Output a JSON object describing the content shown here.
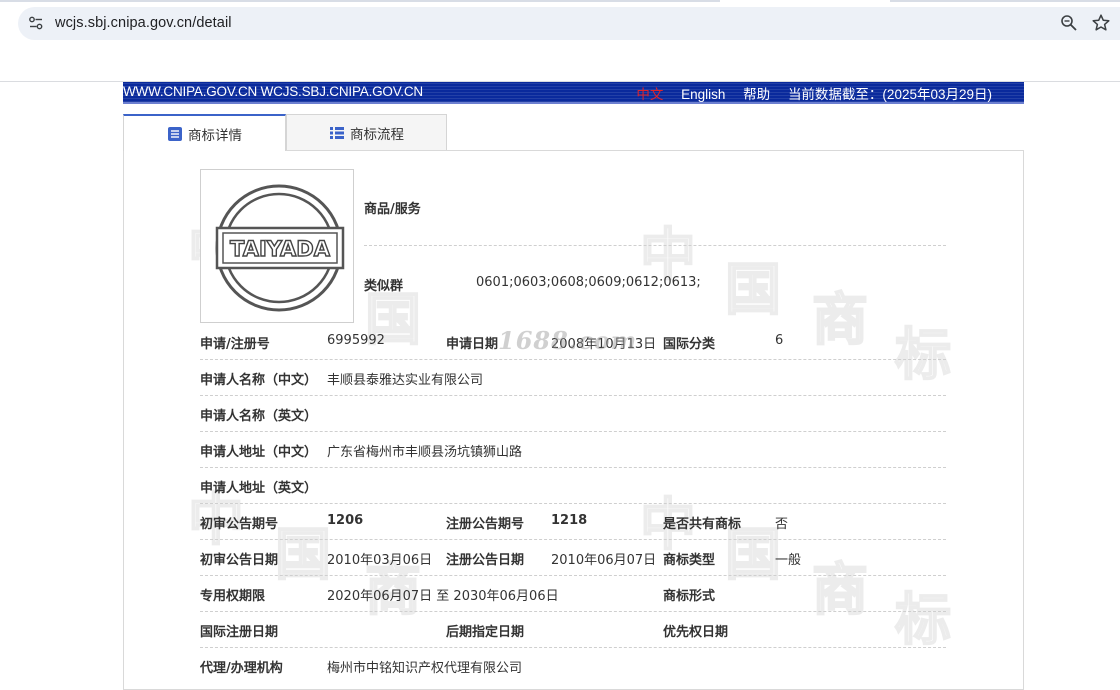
{
  "browser": {
    "url": "wcjs.sbj.cnipa.gov.cn/detail"
  },
  "banner": {
    "sites": "WWW.CNIPA.GOV.CN WCJS.SBJ.CNIPA.GOV.CN",
    "lang_cn": "中文",
    "lang_en": "English",
    "help": "帮助",
    "data_cutoff": "当前数据截至：(2025年03月29日)"
  },
  "tabs": [
    {
      "label": "商标详情",
      "icon": "document-icon",
      "active": true
    },
    {
      "label": "商标流程",
      "icon": "list-icon",
      "active": false
    }
  ],
  "logo": {
    "text": "TAIYADA"
  },
  "goods": {
    "label": "商品/服务",
    "similar_label": "类似群",
    "similar_value": "0601;0603;0608;0609;0612;0613;"
  },
  "watermark": {
    "chars": [
      "中",
      "国",
      "商",
      "标"
    ],
    "site_mark": "1688.com"
  },
  "details": {
    "reg_no_label": "申请/注册号",
    "reg_no": "6995992",
    "app_date_label": "申请日期",
    "app_date": "2008年10月13日",
    "intl_class_label": "国际分类",
    "intl_class": "6",
    "applicant_cn_label": "申请人名称（中文）",
    "applicant_cn": "丰顺县泰雅达实业有限公司",
    "applicant_en_label": "申请人名称（英文）",
    "applicant_en": "",
    "address_cn_label": "申请人地址（中文）",
    "address_cn": "广东省梅州市丰顺县汤坑镇狮山路",
    "address_en_label": "申请人地址（英文）",
    "address_en": "",
    "prelim_no_label": "初审公告期号",
    "prelim_no": "1206",
    "reg_pub_no_label": "注册公告期号",
    "reg_pub_no": "1218",
    "shared_label": "是否共有商标",
    "shared": "否",
    "prelim_date_label": "初审公告日期",
    "prelim_date": "2010年03月06日",
    "reg_pub_date_label": "注册公告日期",
    "reg_pub_date": "2010年06月07日",
    "type_label": "商标类型",
    "type": "一般",
    "period_label": "专用权期限",
    "period": "2020年06月07日 至 2030年06月06日",
    "form_label": "商标形式",
    "form": "",
    "intl_reg_date_label": "国际注册日期",
    "intl_reg_date": "",
    "later_date_label": "后期指定日期",
    "later_date": "",
    "priority_date_label": "优先权日期",
    "priority_date": "",
    "agent_label": "代理/办理机构",
    "agent": "梅州市中铭知识产权代理有限公司"
  },
  "colors": {
    "banner_bg": "#0a2a9c",
    "tab_accent": "#3b63c9",
    "lang_highlight": "#e0232a"
  }
}
